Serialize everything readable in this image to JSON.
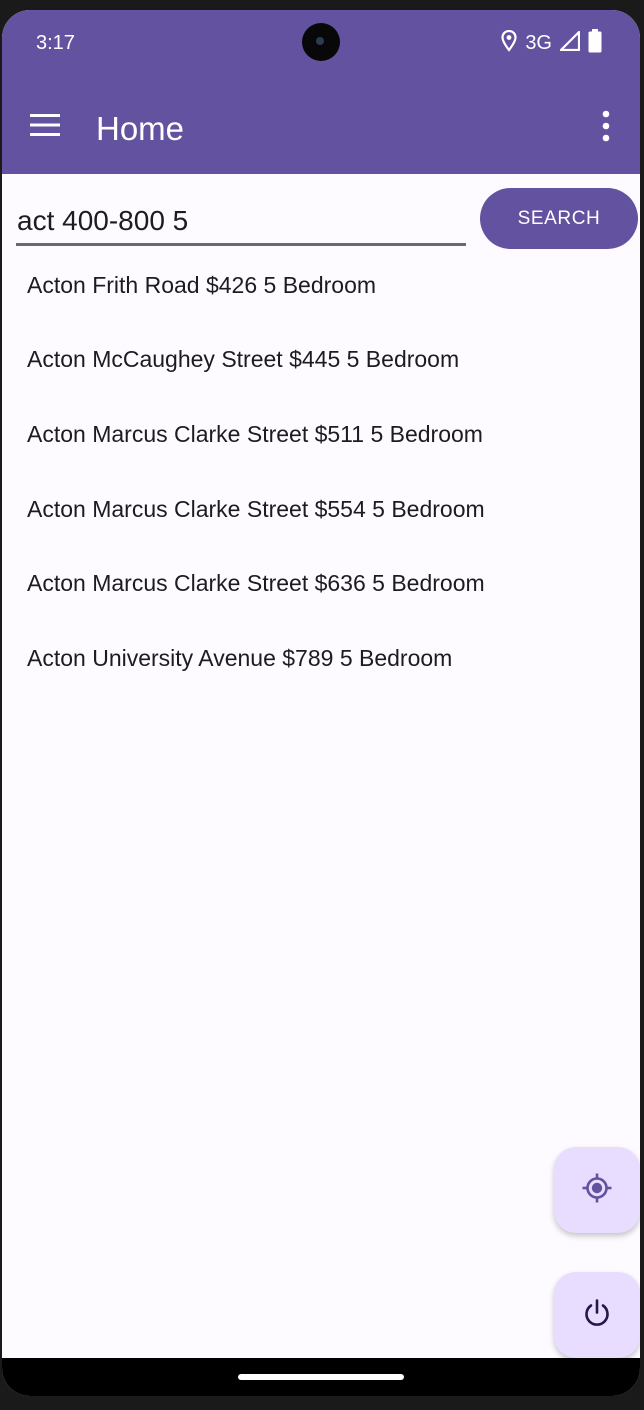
{
  "status_bar": {
    "time": "3:17",
    "network": "3G",
    "icons": [
      "location-icon",
      "signal-icon",
      "battery-icon"
    ]
  },
  "toolbar": {
    "title": "Home",
    "menu_icon": "hamburger-menu-icon",
    "overflow_icon": "more-vertical-icon"
  },
  "search": {
    "value": "act 400-800 5",
    "button_label": "SEARCH"
  },
  "results": [
    "Acton Frith Road $426 5 Bedroom",
    "Acton McCaughey Street $445 5 Bedroom",
    "Acton Marcus Clarke Street $511 5 Bedroom",
    "Acton Marcus Clarke Street $554 5 Bedroom",
    "Acton Marcus Clarke Street $636 5 Bedroom",
    "Acton University Avenue $789 5 Bedroom"
  ],
  "fabs": {
    "locate_icon": "crosshair-location-icon",
    "power_icon": "power-icon"
  },
  "colors": {
    "primary": "#63529f",
    "fab_background": "#e8ddff",
    "surface": "#fdfbff",
    "text": "#1c1b1f"
  }
}
